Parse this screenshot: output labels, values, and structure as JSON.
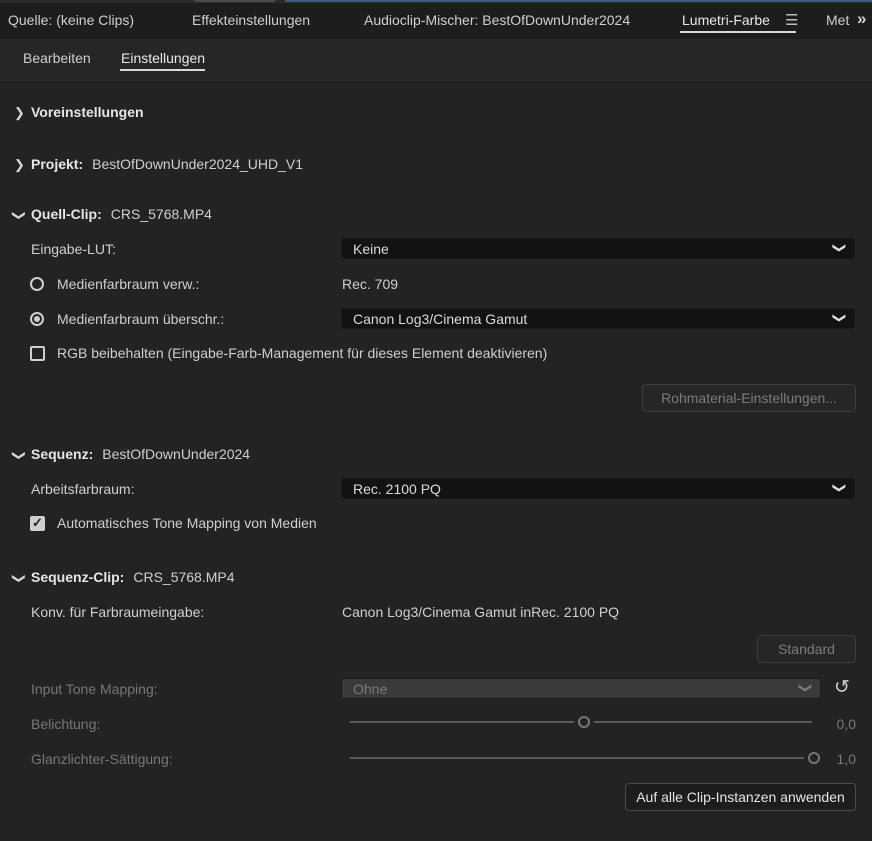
{
  "tabs": [
    {
      "label": "Quelle: (keine Clips)"
    },
    {
      "label": "Effekteinstellungen"
    },
    {
      "label": "Audioclip-Mischer: BestOfDownUnder2024"
    },
    {
      "label": "Lumetri-Farbe"
    },
    {
      "label": "Met"
    }
  ],
  "icons": {
    "menu": "hamburger-menu-icon",
    "overflow": "double-chevron-right-icon",
    "reset": "reset-icon"
  },
  "subtabs": [
    {
      "label": "Bearbeiten"
    },
    {
      "label": "Einstellungen"
    }
  ],
  "sections": {
    "presets": {
      "label": "Voreinstellungen"
    },
    "project": {
      "label": "Projekt:",
      "value": "BestOfDownUnder2024_UHD_V1"
    },
    "source_clip": {
      "label": "Quell-Clip:",
      "value": "CRS_5768.MP4",
      "input_lut_label": "Eingabe-LUT:",
      "input_lut_value": "Keine",
      "media_cs_use_label": "Medienfarbraum verw.:",
      "media_cs_use_value": "Rec. 709",
      "media_cs_override_label": "Medienfarbraum überschr.:",
      "media_cs_override_value": "Canon Log3/Cinema Gamut",
      "preserve_rgb_label": "RGB beibehalten (Eingabe-Farb-Management für dieses Element deaktivieren)",
      "raw_settings_button": "Rohmaterial-Einstellungen..."
    },
    "sequence": {
      "label": "Sequenz:",
      "value": "BestOfDownUnder2024",
      "working_cs_label": "Arbeitsfarbraum:",
      "working_cs_value": "Rec. 2100 PQ",
      "auto_tone_mapping_label": "Automatisches Tone Mapping von Medien"
    },
    "sequence_clip": {
      "label": "Sequenz-Clip:",
      "value": "CRS_5768.MP4",
      "conv_label": "Konv. für Farbraumeingabe:",
      "conv_value": "Canon Log3/Cinema Gamut inRec. 2100 PQ",
      "standard_button": "Standard",
      "input_tone_mapping_label": "Input Tone Mapping:",
      "input_tone_mapping_value": "Ohne",
      "exposure_label": "Belichtung:",
      "exposure_value": "0,0",
      "highlight_sat_label": "Glanzlichter-Sättigung:",
      "highlight_sat_value": "1,0",
      "apply_all_button": "Auf alle Clip-Instanzen anwenden"
    }
  }
}
